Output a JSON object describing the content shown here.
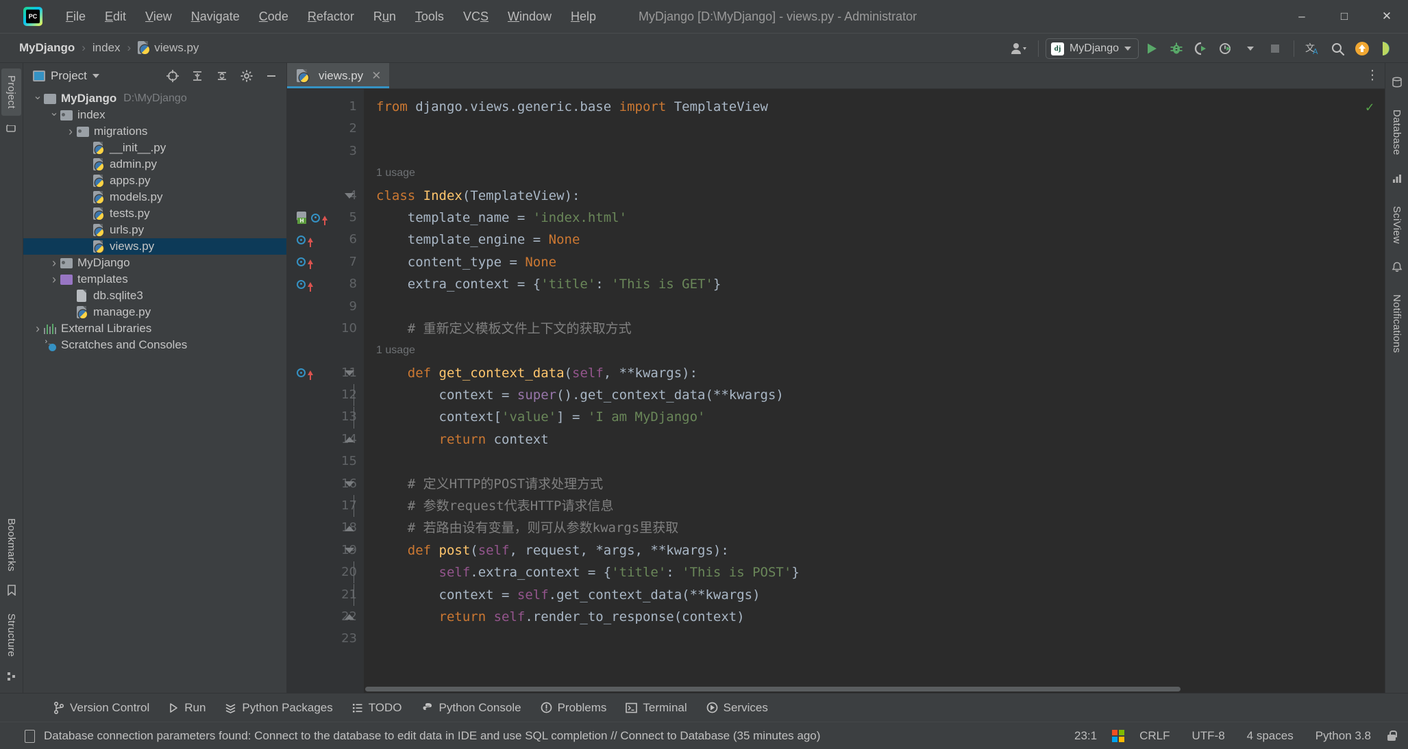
{
  "titlebar": {
    "app_icon": "pycharm-logo-icon",
    "window_title": "MyDjango [D:\\MyDjango] - views.py - Administrator",
    "menus": [
      {
        "label": "File",
        "mnemonic": "F"
      },
      {
        "label": "Edit",
        "mnemonic": "E"
      },
      {
        "label": "View",
        "mnemonic": "V"
      },
      {
        "label": "Navigate",
        "mnemonic": "N"
      },
      {
        "label": "Code",
        "mnemonic": "C"
      },
      {
        "label": "Refactor",
        "mnemonic": "R"
      },
      {
        "label": "Run",
        "mnemonic": "u"
      },
      {
        "label": "Tools",
        "mnemonic": "T"
      },
      {
        "label": "VCS",
        "mnemonic": "S"
      },
      {
        "label": "Window",
        "mnemonic": "W"
      },
      {
        "label": "Help",
        "mnemonic": "H"
      }
    ],
    "minimize": "–",
    "maximize": "□",
    "close": "✕"
  },
  "navbar": {
    "breadcrumbs": [
      {
        "label": "MyDjango",
        "icon": ""
      },
      {
        "label": "index",
        "icon": ""
      },
      {
        "label": "views.py",
        "icon": "python-file-icon"
      }
    ],
    "separator": "›",
    "run_config": {
      "icon": "django-icon",
      "icon_text": "dj",
      "label": "MyDjango"
    },
    "buttons": {
      "user_account": "account-icon",
      "run": "run-icon",
      "debug": "debug-icon",
      "run_coverage": "run-with-coverage-icon",
      "profile": "profiler-icon",
      "stop": "stop-icon",
      "translate": "translate-icon",
      "search_everywhere": "search-icon",
      "update_project": "update-project-icon",
      "feature_trainer": "ide-features-trainer-icon"
    }
  },
  "left_rail": {
    "items": [
      {
        "label": "Project",
        "active": true
      },
      {
        "label": "Bookmarks",
        "active": false
      },
      {
        "label": "Structure",
        "active": false
      }
    ]
  },
  "right_rail": {
    "items": [
      {
        "label": "Database"
      },
      {
        "label": "SciView"
      },
      {
        "label": "Notifications"
      }
    ]
  },
  "project_panel": {
    "title": "Project",
    "view_icon": "project-view-icon",
    "dropdown": "▾",
    "actions": {
      "select_opened_file": "crosshair-icon",
      "expand_all": "expand-all-icon",
      "collapse_all": "collapse-all-icon",
      "settings": "gear-icon",
      "hide": "minimize-icon"
    },
    "tree": [
      {
        "label": "MyDjango",
        "note": "D:\\MyDjango",
        "indent": 0,
        "arrow": "down",
        "icon": "folder",
        "bold": true,
        "selected": false
      },
      {
        "label": "index",
        "note": "",
        "indent": 1,
        "arrow": "down",
        "icon": "folder-source",
        "bold": false,
        "selected": false
      },
      {
        "label": "migrations",
        "note": "",
        "indent": 2,
        "arrow": "right",
        "icon": "folder-source",
        "bold": false,
        "selected": false
      },
      {
        "label": "__init__.py",
        "note": "",
        "indent": 3,
        "arrow": "none",
        "icon": "python-file",
        "bold": false,
        "selected": false
      },
      {
        "label": "admin.py",
        "note": "",
        "indent": 3,
        "arrow": "none",
        "icon": "python-file",
        "bold": false,
        "selected": false
      },
      {
        "label": "apps.py",
        "note": "",
        "indent": 3,
        "arrow": "none",
        "icon": "python-file",
        "bold": false,
        "selected": false
      },
      {
        "label": "models.py",
        "note": "",
        "indent": 3,
        "arrow": "none",
        "icon": "python-file",
        "bold": false,
        "selected": false
      },
      {
        "label": "tests.py",
        "note": "",
        "indent": 3,
        "arrow": "none",
        "icon": "python-file",
        "bold": false,
        "selected": false
      },
      {
        "label": "urls.py",
        "note": "",
        "indent": 3,
        "arrow": "none",
        "icon": "python-file",
        "bold": false,
        "selected": false
      },
      {
        "label": "views.py",
        "note": "",
        "indent": 3,
        "arrow": "none",
        "icon": "python-file",
        "bold": false,
        "selected": true
      },
      {
        "label": "MyDjango",
        "note": "",
        "indent": 1,
        "arrow": "right",
        "icon": "folder-source",
        "bold": false,
        "selected": false
      },
      {
        "label": "templates",
        "note": "",
        "indent": 1,
        "arrow": "right",
        "icon": "folder-templates",
        "bold": false,
        "selected": false
      },
      {
        "label": "db.sqlite3",
        "note": "",
        "indent": 2,
        "arrow": "none",
        "icon": "db-file",
        "bold": false,
        "selected": false
      },
      {
        "label": "manage.py",
        "note": "",
        "indent": 2,
        "arrow": "none",
        "icon": "python-file",
        "bold": false,
        "selected": false
      },
      {
        "label": "External Libraries",
        "note": "",
        "indent": 0,
        "arrow": "right",
        "icon": "library",
        "bold": false,
        "selected": false
      },
      {
        "label": "Scratches and Consoles",
        "note": "",
        "indent": 0,
        "arrow": "none",
        "icon": "scratches",
        "bold": false,
        "selected": false
      }
    ]
  },
  "editor": {
    "tabs": [
      {
        "label": "views.py",
        "icon": "python-file-icon",
        "active": true,
        "close": "✕"
      }
    ],
    "options_icon": "more-options-icon",
    "inspection_status": "✓",
    "lines": [
      {
        "n": 1,
        "inlay": "",
        "gutter": [],
        "fold": "",
        "tokens": [
          {
            "t": "from ",
            "c": "k"
          },
          {
            "t": "django.views.generic.base ",
            "c": "n"
          },
          {
            "t": "import ",
            "c": "k"
          },
          {
            "t": "TemplateView",
            "c": "n"
          }
        ]
      },
      {
        "n": 2,
        "inlay": "",
        "gutter": [],
        "fold": "",
        "tokens": []
      },
      {
        "n": 3,
        "inlay": "",
        "gutter": [],
        "fold": "",
        "tokens": []
      },
      {
        "n": 4,
        "inlay": "1 usage",
        "gutter": [],
        "fold": "start",
        "tokens": [
          {
            "t": "class ",
            "c": "k"
          },
          {
            "t": "Index",
            "c": "fn"
          },
          {
            "t": "(",
            "c": "n"
          },
          {
            "t": "TemplateView",
            "c": "n"
          },
          {
            "t": "):",
            "c": "n"
          }
        ]
      },
      {
        "n": 5,
        "inlay": "",
        "gutter": [
          "html",
          "override"
        ],
        "fold": "",
        "tokens": [
          {
            "t": "    template_name = ",
            "c": "n"
          },
          {
            "t": "'index.html'",
            "c": "s"
          }
        ]
      },
      {
        "n": 6,
        "inlay": "",
        "gutter": [
          "override"
        ],
        "fold": "",
        "tokens": [
          {
            "t": "    template_engine = ",
            "c": "n"
          },
          {
            "t": "None",
            "c": "k"
          }
        ]
      },
      {
        "n": 7,
        "inlay": "",
        "gutter": [
          "override"
        ],
        "fold": "",
        "tokens": [
          {
            "t": "    content_type = ",
            "c": "n"
          },
          {
            "t": "None",
            "c": "k"
          }
        ]
      },
      {
        "n": 8,
        "inlay": "",
        "gutter": [
          "override"
        ],
        "fold": "",
        "tokens": [
          {
            "t": "    extra_context = {",
            "c": "n"
          },
          {
            "t": "'title'",
            "c": "s"
          },
          {
            "t": ": ",
            "c": "n"
          },
          {
            "t": "'This is GET'",
            "c": "s"
          },
          {
            "t": "}",
            "c": "n"
          }
        ]
      },
      {
        "n": 9,
        "inlay": "",
        "gutter": [],
        "fold": "",
        "tokens": []
      },
      {
        "n": 10,
        "inlay": "",
        "gutter": [],
        "fold": "",
        "tokens": [
          {
            "t": "    # 重新定义模板文件上下文的获取方式",
            "c": "c"
          }
        ]
      },
      {
        "n": 11,
        "inlay": "1 usage",
        "gutter": [
          "override"
        ],
        "fold": "start",
        "tokens": [
          {
            "t": "    def ",
            "c": "k"
          },
          {
            "t": "get_context_data",
            "c": "fn"
          },
          {
            "t": "(",
            "c": "n"
          },
          {
            "t": "self",
            "c": "self"
          },
          {
            "t": ", **kwargs):",
            "c": "n"
          }
        ]
      },
      {
        "n": 12,
        "inlay": "",
        "gutter": [],
        "fold": "bar",
        "tokens": [
          {
            "t": "        context = ",
            "c": "n"
          },
          {
            "t": "super",
            "c": "b"
          },
          {
            "t": "().get_context_data(**kwargs)",
            "c": "n"
          }
        ]
      },
      {
        "n": 13,
        "inlay": "",
        "gutter": [],
        "fold": "bar",
        "tokens": [
          {
            "t": "        context[",
            "c": "n"
          },
          {
            "t": "'value'",
            "c": "s"
          },
          {
            "t": "] = ",
            "c": "n"
          },
          {
            "t": "'I am MyDjango'",
            "c": "s"
          }
        ]
      },
      {
        "n": 14,
        "inlay": "",
        "gutter": [],
        "fold": "end",
        "tokens": [
          {
            "t": "        ",
            "c": "n"
          },
          {
            "t": "return ",
            "c": "k"
          },
          {
            "t": "context",
            "c": "n"
          }
        ]
      },
      {
        "n": 15,
        "inlay": "",
        "gutter": [],
        "fold": "",
        "tokens": []
      },
      {
        "n": 16,
        "inlay": "",
        "gutter": [],
        "fold": "start",
        "tokens": [
          {
            "t": "    # 定义HTTP的POST请求处理方式",
            "c": "c"
          }
        ]
      },
      {
        "n": 17,
        "inlay": "",
        "gutter": [],
        "fold": "bar",
        "tokens": [
          {
            "t": "    # 参数request代表HTTP请求信息",
            "c": "c"
          }
        ]
      },
      {
        "n": 18,
        "inlay": "",
        "gutter": [],
        "fold": "end",
        "tokens": [
          {
            "t": "    # 若路由设有变量，则可从参数kwargs里获取",
            "c": "c"
          }
        ]
      },
      {
        "n": 19,
        "inlay": "",
        "gutter": [],
        "fold": "start",
        "tokens": [
          {
            "t": "    def ",
            "c": "k"
          },
          {
            "t": "post",
            "c": "fn"
          },
          {
            "t": "(",
            "c": "n"
          },
          {
            "t": "self",
            "c": "self"
          },
          {
            "t": ", request, *args, **kwargs):",
            "c": "n"
          }
        ]
      },
      {
        "n": 20,
        "inlay": "",
        "gutter": [],
        "fold": "bar",
        "tokens": [
          {
            "t": "        ",
            "c": "n"
          },
          {
            "t": "self",
            "c": "self"
          },
          {
            "t": ".extra_context = {",
            "c": "n"
          },
          {
            "t": "'title'",
            "c": "s"
          },
          {
            "t": ": ",
            "c": "n"
          },
          {
            "t": "'This is POST'",
            "c": "s"
          },
          {
            "t": "}",
            "c": "n"
          }
        ]
      },
      {
        "n": 21,
        "inlay": "",
        "gutter": [],
        "fold": "bar",
        "tokens": [
          {
            "t": "        context = ",
            "c": "n"
          },
          {
            "t": "self",
            "c": "self"
          },
          {
            "t": ".get_context_data(**kwargs)",
            "c": "n"
          }
        ]
      },
      {
        "n": 22,
        "inlay": "",
        "gutter": [],
        "fold": "end",
        "tokens": [
          {
            "t": "        ",
            "c": "n"
          },
          {
            "t": "return ",
            "c": "k"
          },
          {
            "t": "self",
            "c": "self"
          },
          {
            "t": ".render_to_response(context)",
            "c": "n"
          }
        ]
      },
      {
        "n": 23,
        "inlay": "",
        "gutter": [],
        "fold": "",
        "tokens": []
      }
    ]
  },
  "tool_windows": [
    {
      "label": "Version Control",
      "icon": "branch-icon"
    },
    {
      "label": "Run",
      "icon": "run-icon"
    },
    {
      "label": "Python Packages",
      "icon": "packages-icon"
    },
    {
      "label": "TODO",
      "icon": "todo-icon"
    },
    {
      "label": "Python Console",
      "icon": "python-console-icon"
    },
    {
      "label": "Problems",
      "icon": "problems-icon"
    },
    {
      "label": "Terminal",
      "icon": "terminal-icon"
    },
    {
      "label": "Services",
      "icon": "services-icon"
    }
  ],
  "status_bar": {
    "message_icon": "database-notification-icon",
    "message": "Database connection parameters found: Connect to the database to edit data in IDE and use SQL completion // Connect to Database (35 minutes ago)",
    "caret_position": "23:1",
    "os_icon": "windows-icon",
    "line_separator": "CRLF",
    "encoding": "UTF-8",
    "indent": "4 spaces",
    "interpreter": "Python 3.8",
    "lock_icon": "lock-icon"
  },
  "colors": {
    "accent_blue": "#3592c4",
    "selection_navy": "#0d3a58",
    "run_green": "#59a869",
    "editor_bg": "#2b2b2b",
    "panel_bg": "#3c3f41",
    "gutter_bg": "#313335",
    "string_green": "#6a8759",
    "keyword_orange": "#cc7832",
    "function_yellow": "#ffc66d",
    "comment_gray": "#808080",
    "self_purple": "#94558d"
  }
}
